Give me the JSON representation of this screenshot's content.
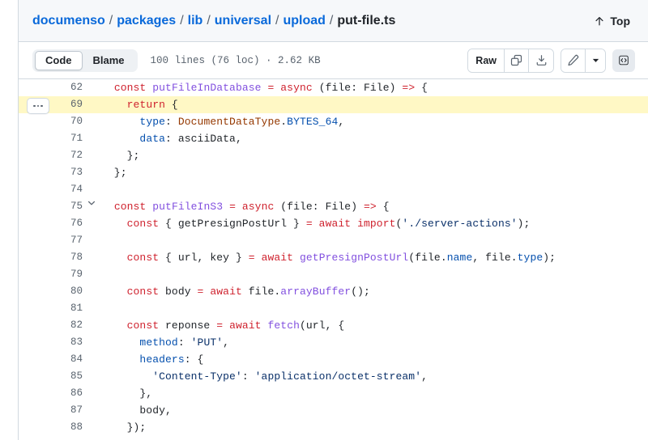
{
  "breadcrumb": {
    "parts": [
      {
        "text": "documenso",
        "type": "link"
      },
      {
        "text": "packages",
        "type": "link"
      },
      {
        "text": "lib",
        "type": "link"
      },
      {
        "text": "universal",
        "type": "link"
      },
      {
        "text": "upload",
        "type": "link"
      },
      {
        "text": "put-file.ts",
        "type": "current"
      }
    ],
    "separator": "/"
  },
  "top_button": {
    "label": "Top",
    "icon": "arrow-up-icon"
  },
  "toolbar": {
    "tabs": [
      {
        "label": "Code",
        "active": true
      },
      {
        "label": "Blame",
        "active": false
      }
    ],
    "file_meta": "100 lines (76 loc) · 2.62 KB",
    "raw_label": "Raw",
    "copy_icon": "copy-icon",
    "download_icon": "download-icon",
    "edit_icon": "pencil-icon",
    "more_icon": "chevron-down-icon",
    "symbols_icon": "code-symbols-icon"
  },
  "colors": {
    "keyword": "#cf222e",
    "function": "#8250df",
    "property": "#0550ae",
    "string": "#0a3069",
    "variable": "#953800",
    "link": "#0969da",
    "highlight": "#fff8c5",
    "border": "#d1d9e0",
    "header_bg": "#f6f8fa"
  },
  "code": {
    "lines": [
      {
        "number": "62",
        "highlight": false,
        "fold": "",
        "expand": false,
        "tokens": [
          {
            "t": "  ",
            "c": "pl"
          },
          {
            "t": "const",
            "c": "kw"
          },
          {
            "t": " ",
            "c": "pl"
          },
          {
            "t": "putFileInDatabase",
            "c": "fn"
          },
          {
            "t": " ",
            "c": "pl"
          },
          {
            "t": "=",
            "c": "kw"
          },
          {
            "t": " ",
            "c": "pl"
          },
          {
            "t": "async",
            "c": "kw"
          },
          {
            "t": " (file: File) ",
            "c": "pl"
          },
          {
            "t": "=>",
            "c": "kw"
          },
          {
            "t": " {",
            "c": "pl"
          }
        ]
      },
      {
        "number": "69",
        "highlight": true,
        "fold": "",
        "expand": true,
        "tokens": [
          {
            "t": "    ",
            "c": "pl"
          },
          {
            "t": "return",
            "c": "kw"
          },
          {
            "t": " {",
            "c": "pl"
          }
        ]
      },
      {
        "number": "70",
        "highlight": false,
        "fold": "",
        "expand": false,
        "tokens": [
          {
            "t": "      ",
            "c": "pl"
          },
          {
            "t": "type",
            "c": "prop"
          },
          {
            "t": ": ",
            "c": "pl"
          },
          {
            "t": "DocumentDataType",
            "c": "var"
          },
          {
            "t": ".",
            "c": "pl"
          },
          {
            "t": "BYTES_64",
            "c": "prop"
          },
          {
            "t": ",",
            "c": "pl"
          }
        ]
      },
      {
        "number": "71",
        "highlight": false,
        "fold": "",
        "expand": false,
        "tokens": [
          {
            "t": "      ",
            "c": "pl"
          },
          {
            "t": "data",
            "c": "prop"
          },
          {
            "t": ": asciiData,",
            "c": "pl"
          }
        ]
      },
      {
        "number": "72",
        "highlight": false,
        "fold": "",
        "expand": false,
        "tokens": [
          {
            "t": "    };",
            "c": "pl"
          }
        ]
      },
      {
        "number": "73",
        "highlight": false,
        "fold": "",
        "expand": false,
        "tokens": [
          {
            "t": "  };",
            "c": "pl"
          }
        ]
      },
      {
        "number": "74",
        "highlight": false,
        "fold": "",
        "expand": false,
        "tokens": [
          {
            "t": "",
            "c": "pl"
          }
        ]
      },
      {
        "number": "75",
        "highlight": false,
        "fold": "chevron-down",
        "expand": false,
        "tokens": [
          {
            "t": "  ",
            "c": "pl"
          },
          {
            "t": "const",
            "c": "kw"
          },
          {
            "t": " ",
            "c": "pl"
          },
          {
            "t": "putFileInS3",
            "c": "fn"
          },
          {
            "t": " ",
            "c": "pl"
          },
          {
            "t": "=",
            "c": "kw"
          },
          {
            "t": " ",
            "c": "pl"
          },
          {
            "t": "async",
            "c": "kw"
          },
          {
            "t": " (file: File) ",
            "c": "pl"
          },
          {
            "t": "=>",
            "c": "kw"
          },
          {
            "t": " {",
            "c": "pl"
          }
        ]
      },
      {
        "number": "76",
        "highlight": false,
        "fold": "",
        "expand": false,
        "tokens": [
          {
            "t": "    ",
            "c": "pl"
          },
          {
            "t": "const",
            "c": "kw"
          },
          {
            "t": " { getPresignPostUrl } ",
            "c": "pl"
          },
          {
            "t": "=",
            "c": "kw"
          },
          {
            "t": " ",
            "c": "pl"
          },
          {
            "t": "await",
            "c": "kw"
          },
          {
            "t": " ",
            "c": "pl"
          },
          {
            "t": "import",
            "c": "kw"
          },
          {
            "t": "(",
            "c": "pl"
          },
          {
            "t": "'./server-actions'",
            "c": "str"
          },
          {
            "t": ");",
            "c": "pl"
          }
        ]
      },
      {
        "number": "77",
        "highlight": false,
        "fold": "",
        "expand": false,
        "tokens": [
          {
            "t": "",
            "c": "pl"
          }
        ]
      },
      {
        "number": "78",
        "highlight": false,
        "fold": "",
        "expand": false,
        "tokens": [
          {
            "t": "    ",
            "c": "pl"
          },
          {
            "t": "const",
            "c": "kw"
          },
          {
            "t": " { url, key } ",
            "c": "pl"
          },
          {
            "t": "=",
            "c": "kw"
          },
          {
            "t": " ",
            "c": "pl"
          },
          {
            "t": "await",
            "c": "kw"
          },
          {
            "t": " ",
            "c": "pl"
          },
          {
            "t": "getPresignPostUrl",
            "c": "fn"
          },
          {
            "t": "(file.",
            "c": "pl"
          },
          {
            "t": "name",
            "c": "prop"
          },
          {
            "t": ", file.",
            "c": "pl"
          },
          {
            "t": "type",
            "c": "prop"
          },
          {
            "t": ");",
            "c": "pl"
          }
        ]
      },
      {
        "number": "79",
        "highlight": false,
        "fold": "",
        "expand": false,
        "tokens": [
          {
            "t": "",
            "c": "pl"
          }
        ]
      },
      {
        "number": "80",
        "highlight": false,
        "fold": "",
        "expand": false,
        "tokens": [
          {
            "t": "    ",
            "c": "pl"
          },
          {
            "t": "const",
            "c": "kw"
          },
          {
            "t": " body ",
            "c": "pl"
          },
          {
            "t": "=",
            "c": "kw"
          },
          {
            "t": " ",
            "c": "pl"
          },
          {
            "t": "await",
            "c": "kw"
          },
          {
            "t": " file.",
            "c": "pl"
          },
          {
            "t": "arrayBuffer",
            "c": "fn"
          },
          {
            "t": "();",
            "c": "pl"
          }
        ]
      },
      {
        "number": "81",
        "highlight": false,
        "fold": "",
        "expand": false,
        "tokens": [
          {
            "t": "",
            "c": "pl"
          }
        ]
      },
      {
        "number": "82",
        "highlight": false,
        "fold": "",
        "expand": false,
        "tokens": [
          {
            "t": "    ",
            "c": "pl"
          },
          {
            "t": "const",
            "c": "kw"
          },
          {
            "t": " reponse ",
            "c": "pl"
          },
          {
            "t": "=",
            "c": "kw"
          },
          {
            "t": " ",
            "c": "pl"
          },
          {
            "t": "await",
            "c": "kw"
          },
          {
            "t": " ",
            "c": "pl"
          },
          {
            "t": "fetch",
            "c": "fn"
          },
          {
            "t": "(url, {",
            "c": "pl"
          }
        ]
      },
      {
        "number": "83",
        "highlight": false,
        "fold": "",
        "expand": false,
        "tokens": [
          {
            "t": "      ",
            "c": "pl"
          },
          {
            "t": "method",
            "c": "prop"
          },
          {
            "t": ": ",
            "c": "pl"
          },
          {
            "t": "'PUT'",
            "c": "str"
          },
          {
            "t": ",",
            "c": "pl"
          }
        ]
      },
      {
        "number": "84",
        "highlight": false,
        "fold": "",
        "expand": false,
        "tokens": [
          {
            "t": "      ",
            "c": "pl"
          },
          {
            "t": "headers",
            "c": "prop"
          },
          {
            "t": ": {",
            "c": "pl"
          }
        ]
      },
      {
        "number": "85",
        "highlight": false,
        "fold": "",
        "expand": false,
        "tokens": [
          {
            "t": "        ",
            "c": "pl"
          },
          {
            "t": "'Content-Type'",
            "c": "str"
          },
          {
            "t": ": ",
            "c": "pl"
          },
          {
            "t": "'application/octet-stream'",
            "c": "str"
          },
          {
            "t": ",",
            "c": "pl"
          }
        ]
      },
      {
        "number": "86",
        "highlight": false,
        "fold": "",
        "expand": false,
        "tokens": [
          {
            "t": "      },",
            "c": "pl"
          }
        ]
      },
      {
        "number": "87",
        "highlight": false,
        "fold": "",
        "expand": false,
        "tokens": [
          {
            "t": "      body,",
            "c": "pl"
          }
        ]
      },
      {
        "number": "88",
        "highlight": false,
        "fold": "",
        "expand": false,
        "tokens": [
          {
            "t": "    });",
            "c": "pl"
          }
        ]
      }
    ]
  }
}
